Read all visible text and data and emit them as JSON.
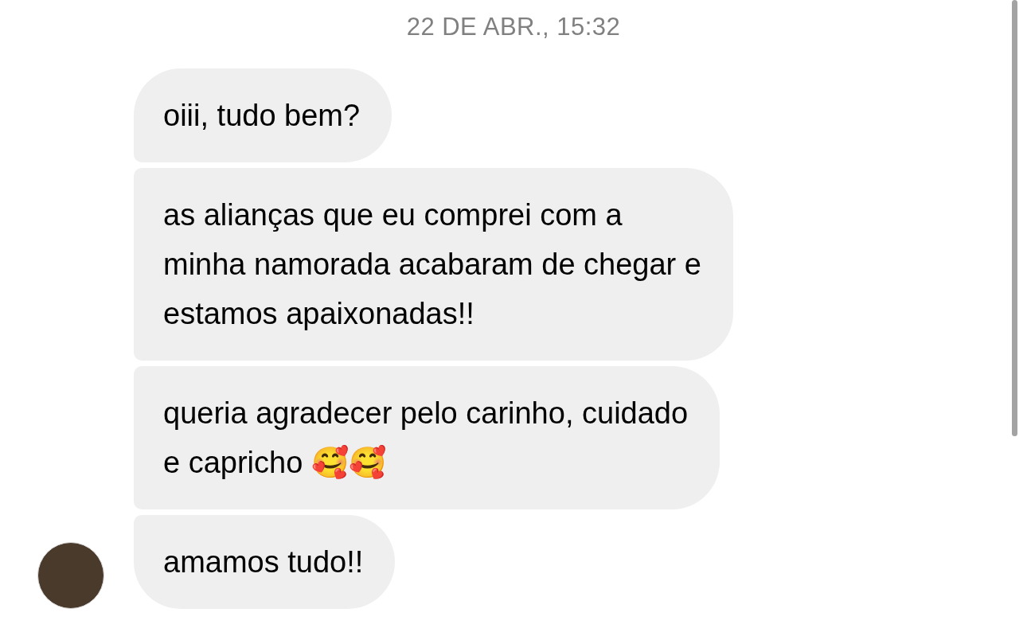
{
  "timestamp": "22 DE ABR., 15:32",
  "messages": [
    {
      "text": "oiii, tudo bem?"
    },
    {
      "text": "as alianças que eu comprei com a\nminha namorada acabaram de chegar e\nestamos apaixonadas!!"
    },
    {
      "text": "queria agradecer pelo carinho, cuidado\ne capricho 🥰🥰"
    },
    {
      "text": "amamos tudo!!"
    }
  ]
}
